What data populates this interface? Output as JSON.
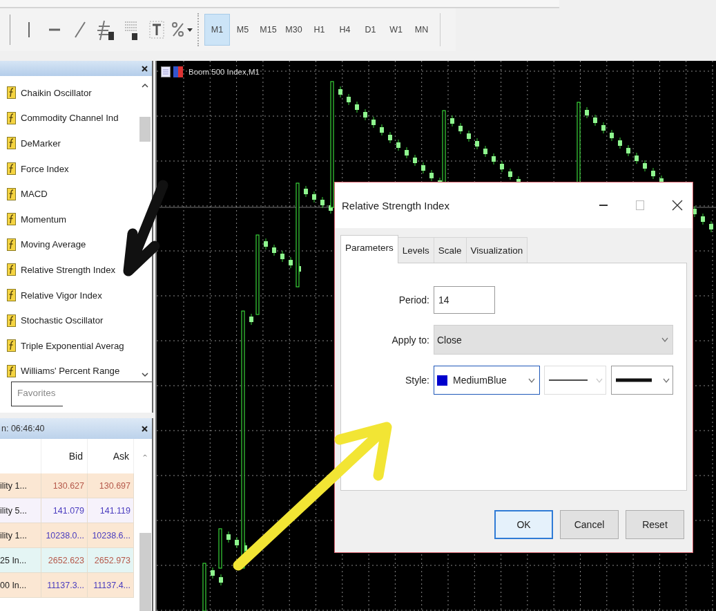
{
  "toolbar": {
    "timeframes": [
      {
        "label": "M1",
        "selected": true
      },
      {
        "label": "M5",
        "selected": false
      },
      {
        "label": "M15",
        "selected": false
      },
      {
        "label": "M30",
        "selected": false
      },
      {
        "label": "H1",
        "selected": false
      },
      {
        "label": "H4",
        "selected": false
      },
      {
        "label": "D1",
        "selected": false
      },
      {
        "label": "W1",
        "selected": false
      },
      {
        "label": "MN",
        "selected": false
      }
    ]
  },
  "navigator": {
    "items": [
      {
        "label": "Chaikin Oscillator"
      },
      {
        "label": "Commodity Channel Ind"
      },
      {
        "label": "DeMarker"
      },
      {
        "label": "Force Index"
      },
      {
        "label": "MACD"
      },
      {
        "label": "Momentum"
      },
      {
        "label": "Moving Average"
      },
      {
        "label": "Relative Strength Index"
      },
      {
        "label": "Relative Vigor Index"
      },
      {
        "label": "Stochastic Oscillator"
      },
      {
        "label": "Triple Exponential Averag"
      },
      {
        "label": "Williams' Percent Range"
      }
    ],
    "tab": "Favorites"
  },
  "market_watch": {
    "title": "n: 06:46:40",
    "columns": [
      "Bid",
      "Ask"
    ],
    "rows": [
      {
        "symbol": "ility 1...",
        "bid": "130.627",
        "ask": "130.697",
        "color": "#b5584a"
      },
      {
        "symbol": "ility 5...",
        "bid": "141.079",
        "ask": "141.119",
        "color": "#4a3cbf"
      },
      {
        "symbol": "ility 1...",
        "bid": "10238.0...",
        "ask": "10238.6...",
        "color": "#4a3cbf"
      },
      {
        "symbol": "25 In...",
        "bid": "2652.623",
        "ask": "2652.973",
        "color": "#b5584a"
      },
      {
        "symbol": "00 In...",
        "bid": "11137.3...",
        "ask": "11137.4...",
        "color": "#4a3cbf"
      }
    ]
  },
  "chart": {
    "title": "Boom 500 Index,M1"
  },
  "dialog": {
    "title": "Relative Strength Index",
    "tabs": [
      {
        "label": "Parameters",
        "selected": true
      },
      {
        "label": "Levels",
        "selected": false
      },
      {
        "label": "Scale",
        "selected": false
      },
      {
        "label": "Visualization",
        "selected": false
      }
    ],
    "fields": [
      {
        "kind": "input",
        "label": "Period:",
        "value": "14"
      },
      {
        "kind": "dropdown",
        "label": "Apply to:",
        "value": "Close"
      },
      {
        "kind": "style",
        "label": "Style:",
        "value": "MediumBlue",
        "color": "#0000cd"
      }
    ],
    "buttons": [
      {
        "label": "OK",
        "default": true
      },
      {
        "label": "Cancel",
        "default": false
      },
      {
        "label": "Reset",
        "default": false
      }
    ]
  }
}
